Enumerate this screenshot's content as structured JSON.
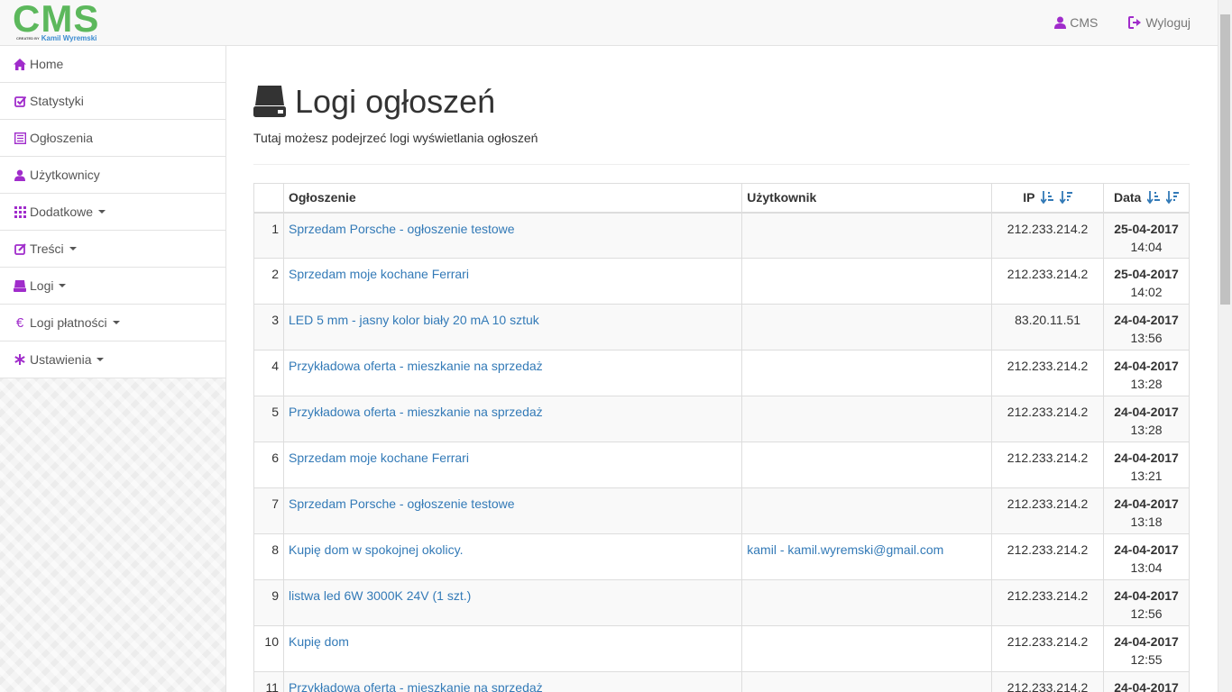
{
  "brand": {
    "logo_text": "CMS",
    "logo_created": "CREATED BY",
    "logo_author": "Kamil Wyremski"
  },
  "navbar": {
    "cms_label": "CMS",
    "logout_label": "Wyloguj"
  },
  "sidebar": {
    "items": [
      {
        "label": "Home",
        "icon": "home-icon",
        "dropdown": false
      },
      {
        "label": "Statystyki",
        "icon": "check-square-icon",
        "dropdown": false
      },
      {
        "label": "Ogłoszenia",
        "icon": "list-alt-icon",
        "dropdown": false
      },
      {
        "label": "Użytkownicy",
        "icon": "user-icon",
        "dropdown": false
      },
      {
        "label": "Dodatkowe",
        "icon": "grid-icon",
        "dropdown": true
      },
      {
        "label": "Treści",
        "icon": "edit-icon",
        "dropdown": true
      },
      {
        "label": "Logi",
        "icon": "hdd-icon",
        "dropdown": true
      },
      {
        "label": "Logi płatności",
        "icon": "euro-icon",
        "dropdown": true
      },
      {
        "label": "Ustawienia",
        "icon": "asterisk-icon",
        "dropdown": true
      }
    ]
  },
  "page": {
    "title": "Logi ogłoszeń",
    "subtitle": "Tutaj możesz podejrzeć logi wyświetlania ogłoszeń"
  },
  "table": {
    "headers": {
      "num": "",
      "ad": "Ogłoszenie",
      "user": "Użytkownik",
      "ip": "IP",
      "date": "Data"
    },
    "rows": [
      {
        "num": "1",
        "ad": "Sprzedam Porsche - ogłoszenie testowe",
        "user": "",
        "ip": "212.233.214.2",
        "date": "25-04-2017",
        "time": "14:04"
      },
      {
        "num": "2",
        "ad": "Sprzedam moje kochane Ferrari",
        "user": "",
        "ip": "212.233.214.2",
        "date": "25-04-2017",
        "time": "14:02"
      },
      {
        "num": "3",
        "ad": "LED 5 mm - jasny kolor biały 20 mA 10 sztuk",
        "user": "",
        "ip": "83.20.11.51",
        "date": "24-04-2017",
        "time": "13:56"
      },
      {
        "num": "4",
        "ad": "Przykładowa oferta - mieszkanie na sprzedaż",
        "user": "",
        "ip": "212.233.214.2",
        "date": "24-04-2017",
        "time": "13:28"
      },
      {
        "num": "5",
        "ad": "Przykładowa oferta - mieszkanie na sprzedaż",
        "user": "",
        "ip": "212.233.214.2",
        "date": "24-04-2017",
        "time": "13:28"
      },
      {
        "num": "6",
        "ad": "Sprzedam moje kochane Ferrari",
        "user": "",
        "ip": "212.233.214.2",
        "date": "24-04-2017",
        "time": "13:21"
      },
      {
        "num": "7",
        "ad": "Sprzedam Porsche - ogłoszenie testowe",
        "user": "",
        "ip": "212.233.214.2",
        "date": "24-04-2017",
        "time": "13:18"
      },
      {
        "num": "8",
        "ad": "Kupię dom w spokojnej okolicy.",
        "user": "kamil - kamil.wyremski@gmail.com",
        "ip": "212.233.214.2",
        "date": "24-04-2017",
        "time": "13:04"
      },
      {
        "num": "9",
        "ad": "listwa led 6W 3000K 24V (1 szt.)",
        "user": "",
        "ip": "212.233.214.2",
        "date": "24-04-2017",
        "time": "12:56"
      },
      {
        "num": "10",
        "ad": "Kupię dom",
        "user": "",
        "ip": "212.233.214.2",
        "date": "24-04-2017",
        "time": "12:55"
      },
      {
        "num": "11",
        "ad": "Przykładowa oferta - mieszkanie na sprzedaż",
        "user": "",
        "ip": "212.233.214.2",
        "date": "24-04-2017",
        "time": ""
      }
    ]
  },
  "colors": {
    "accent": "#a02ccb",
    "link": "#337ab7",
    "logo_green": "#5cb85c"
  }
}
